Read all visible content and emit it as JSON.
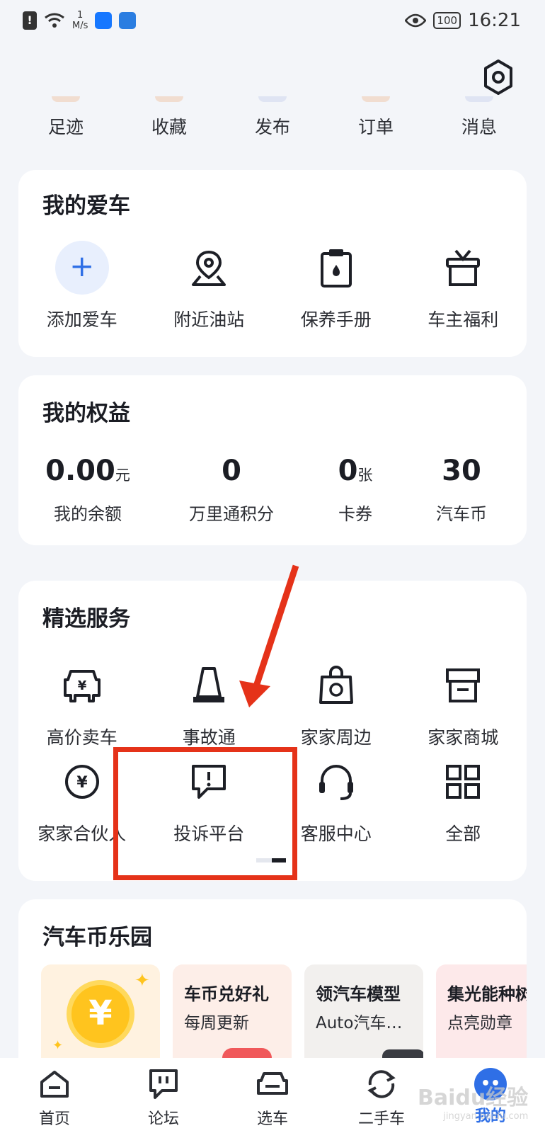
{
  "status_bar": {
    "speed_value": "1",
    "speed_unit": "M/s",
    "battery": "100",
    "time": "16:21"
  },
  "quick_links": [
    "足迹",
    "收藏",
    "发布",
    "订单",
    "消息"
  ],
  "my_car": {
    "title": "我的爱车",
    "items": [
      {
        "label": "添加爱车",
        "icon": "plus-icon"
      },
      {
        "label": "附近油站",
        "icon": "map-pin-icon"
      },
      {
        "label": "保养手册",
        "icon": "clipboard-drop-icon"
      },
      {
        "label": "车主福利",
        "icon": "gift-box-icon"
      }
    ]
  },
  "rights": {
    "title": "我的权益",
    "stats": [
      {
        "value": "0.00",
        "unit": "元",
        "label": "我的余额"
      },
      {
        "value": "0",
        "unit": "",
        "label": "万里通积分"
      },
      {
        "value": "0",
        "unit": "张",
        "label": "卡券"
      },
      {
        "value": "30",
        "unit": "",
        "label": "汽车币"
      }
    ]
  },
  "services": {
    "title": "精选服务",
    "row1": [
      {
        "label": "高价卖车",
        "icon": "car-yen-icon"
      },
      {
        "label": "事故通",
        "icon": "traffic-cone-icon"
      },
      {
        "label": "家家周边",
        "icon": "shopping-bag-icon"
      },
      {
        "label": "家家商城",
        "icon": "storefront-icon"
      }
    ],
    "row2": [
      {
        "label": "家家合伙人",
        "icon": "yen-circle-icon"
      },
      {
        "label": "投诉平台",
        "icon": "complaint-bubble-icon"
      },
      {
        "label": "客服中心",
        "icon": "headset-icon"
      },
      {
        "label": "全部",
        "icon": "grid-icon"
      }
    ]
  },
  "coin_park": {
    "title": "汽车币乐园",
    "coin_symbol": "¥",
    "tiles": [
      {
        "title": "",
        "sub": ""
      },
      {
        "title": "车币兑好礼",
        "sub": "每周更新"
      },
      {
        "title": "领汽车模型",
        "sub": "Auto汽车…"
      },
      {
        "title": "集光能种树",
        "sub": "点亮勋章"
      }
    ]
  },
  "tab_bar": [
    {
      "label": "首页",
      "icon": "home-icon"
    },
    {
      "label": "论坛",
      "icon": "forum-icon"
    },
    {
      "label": "选车",
      "icon": "car-front-icon"
    },
    {
      "label": "二手车",
      "icon": "refresh-icon"
    },
    {
      "label": "我的",
      "icon": "profile-icon"
    }
  ],
  "watermark": {
    "main": "Baidu经验",
    "sub": "jingyan.baidu.com"
  },
  "accent_color": "#2f6fe6",
  "highlight_color": "#e53219"
}
